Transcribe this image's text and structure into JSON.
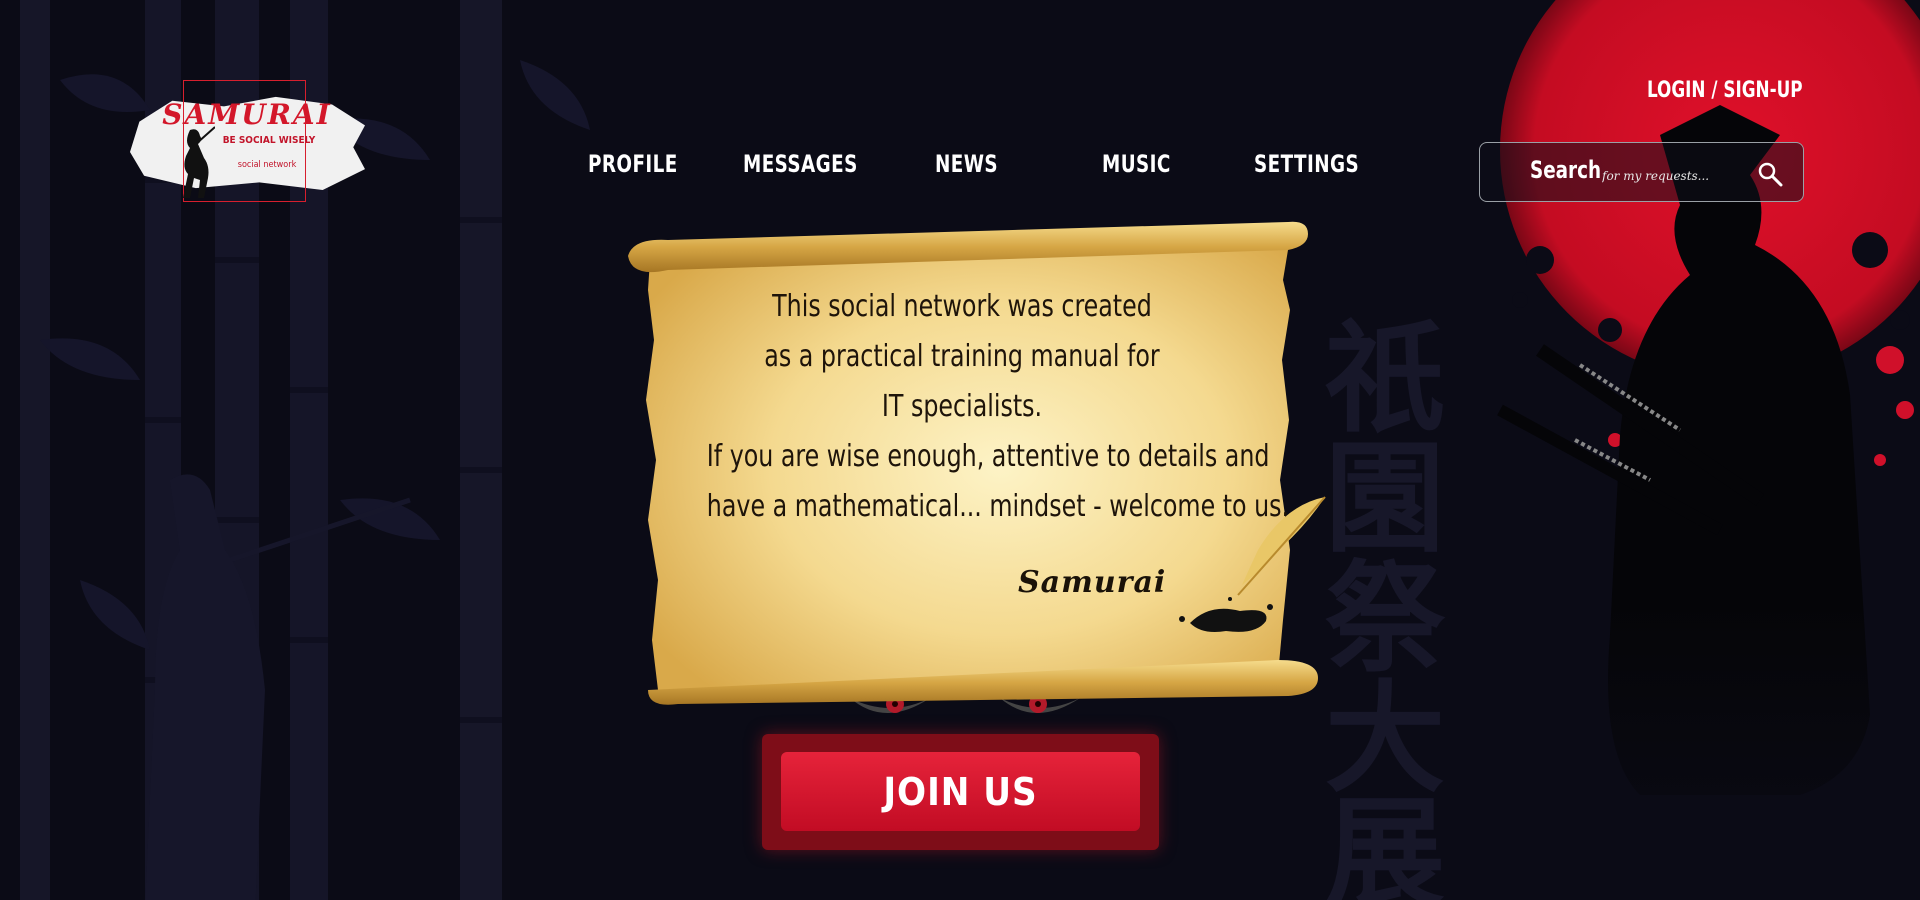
{
  "logo": {
    "name": "SAMURAI",
    "tagline": "BE SOCIAL WISELY",
    "subtitle": "social network"
  },
  "nav": {
    "items": [
      {
        "label": "PROFILE"
      },
      {
        "label": "MESSAGES"
      },
      {
        "label": "NEWS"
      },
      {
        "label": "MUSIC"
      },
      {
        "label": "SETTINGS"
      }
    ]
  },
  "auth": {
    "login_label": "LOGIN / SIGN-UP"
  },
  "search": {
    "label": "Search",
    "placeholder": "for my requests..."
  },
  "scroll": {
    "lines": [
      "This social network was created",
      "as a practical training manual for",
      "IT specialists.",
      "If you are wise enough, attentive to details and",
      "have a mathematical... mindset - welcome to us."
    ],
    "signature": "Samurai"
  },
  "cta": {
    "join_label": "JOIN US"
  },
  "colors": {
    "background": "#0b0b16",
    "accent_red": "#d3172a",
    "button_red": "#e6233a",
    "parchment": "#f2d588"
  },
  "icons": [
    "search-icon",
    "quill-icon",
    "samurai-logo-icon"
  ]
}
